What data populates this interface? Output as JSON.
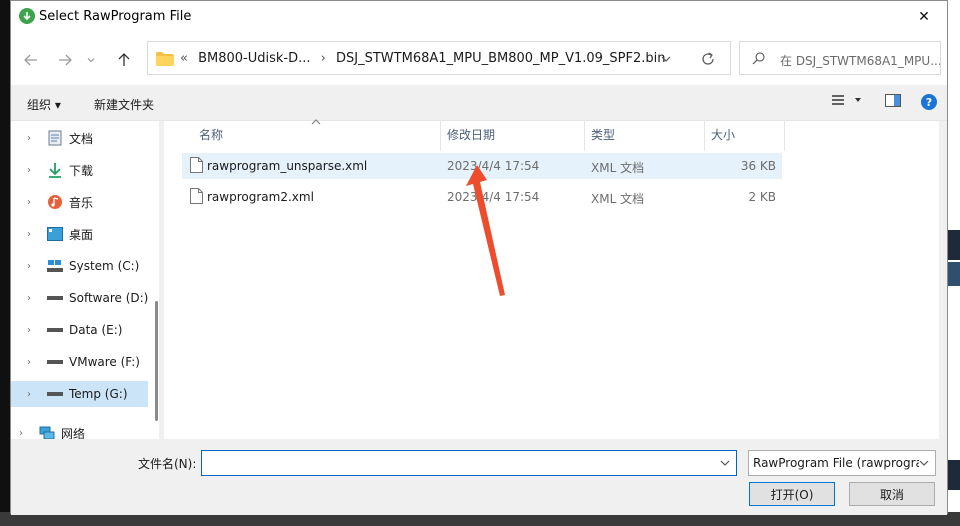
{
  "window": {
    "title": "Select RawProgram File",
    "close_symbol": "✕"
  },
  "nav": {
    "breadcrumb": [
      "«",
      "BM800-Udisk-D...",
      "›",
      "DSJ_STWTM68A1_MPU_BM800_MP_V1.09_SPF2.bin"
    ],
    "search_placeholder": "在 DSJ_STWTM68A1_MPU..."
  },
  "toolbar": {
    "organize": "组织 ▾",
    "new_folder": "新建文件夹"
  },
  "sidebar": {
    "items": [
      {
        "label": "文档",
        "icon": "documents-icon"
      },
      {
        "label": "下载",
        "icon": "downloads-icon"
      },
      {
        "label": "音乐",
        "icon": "music-icon"
      },
      {
        "label": "桌面",
        "icon": "desktop-icon"
      },
      {
        "label": "System (C:)",
        "icon": "system-drive-icon"
      },
      {
        "label": "Software (D:)",
        "icon": "drive-icon"
      },
      {
        "label": "Data (E:)",
        "icon": "drive-icon"
      },
      {
        "label": "VMware (F:)",
        "icon": "drive-icon"
      },
      {
        "label": "Temp (G:)",
        "icon": "drive-icon",
        "selected": true
      },
      {
        "label": "网络",
        "icon": "network-icon"
      }
    ]
  },
  "columns": {
    "name": "名称",
    "modified": "修改日期",
    "type": "类型",
    "size": "大小"
  },
  "files": [
    {
      "name": "rawprogram_unsparse.xml",
      "modified": "2023/4/4 17:54",
      "type": "XML 文档",
      "size": "36 KB"
    },
    {
      "name": "rawprogram2.xml",
      "modified": "2023/4/4 17:54",
      "type": "XML 文档",
      "size": "2 KB"
    }
  ],
  "footer": {
    "filename_label": "文件名(N):",
    "filename_value": "",
    "filetype_selected": "RawProgram File (rawprogra",
    "open_button": "打开(O)",
    "cancel_button": "取消"
  },
  "annotation": {
    "arrow_color": "#ee4d2d"
  }
}
